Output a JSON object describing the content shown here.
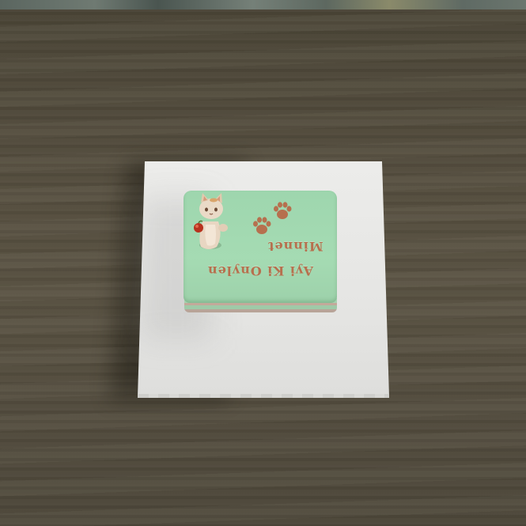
{
  "scene": {
    "cake": {
      "text_line1": "Minnet",
      "text_line2": "Ayi Ki Onylen",
      "topping_icons": [
        "paw-print-icon",
        "paw-print-icon",
        "cat-figurine-icon"
      ]
    },
    "colors": {
      "icing": "#a5dbb3",
      "lettering": "#b6704e",
      "board": "#e8e8e6",
      "table": "#554e40"
    }
  }
}
